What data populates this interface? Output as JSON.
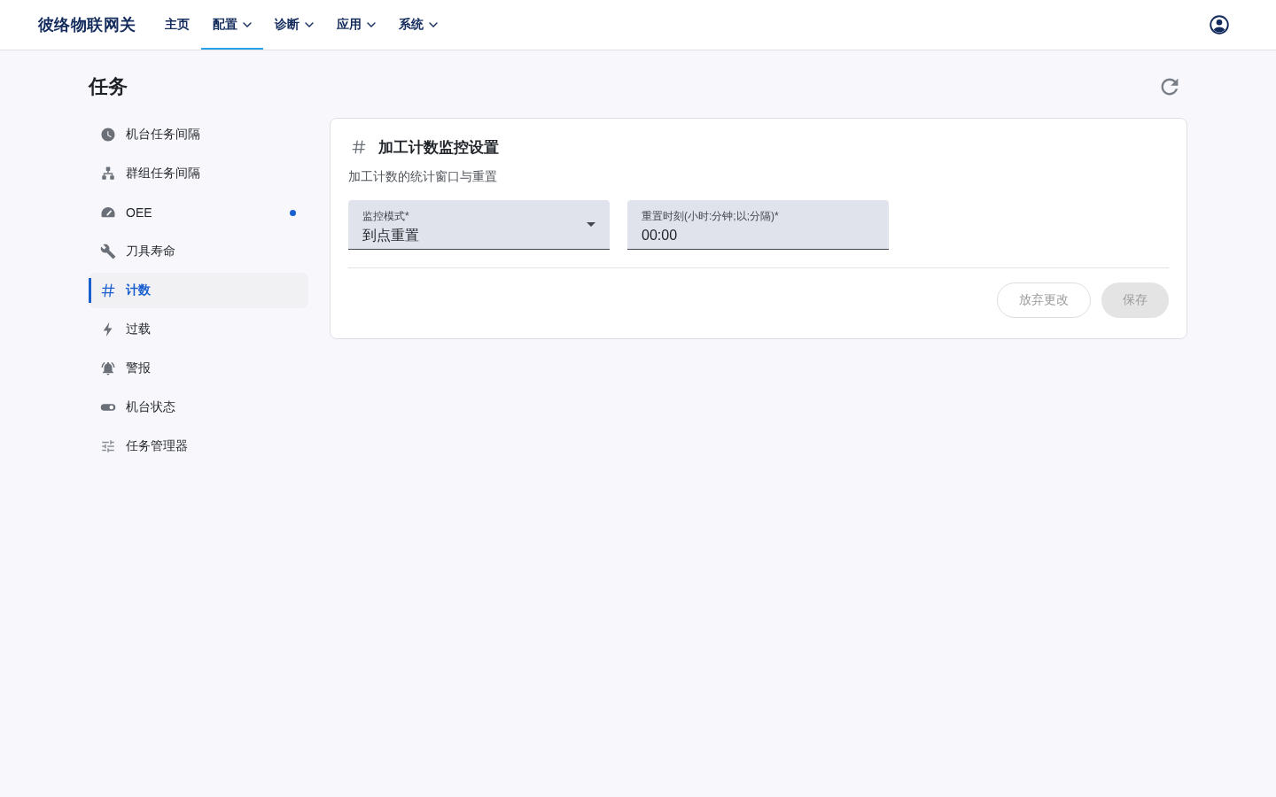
{
  "header": {
    "brand": "彼络物联网关",
    "nav": [
      {
        "label": "主页",
        "kind": "link",
        "selected": false
      },
      {
        "label": "配置",
        "kind": "menu",
        "selected": true
      },
      {
        "label": "诊断",
        "kind": "menu",
        "selected": false
      },
      {
        "label": "应用",
        "kind": "menu",
        "selected": false
      },
      {
        "label": "系统",
        "kind": "menu",
        "selected": false
      }
    ]
  },
  "page": {
    "title": "任务"
  },
  "sidebar": {
    "items": [
      {
        "label": "机台任务间隔",
        "selected": false,
        "dot": false
      },
      {
        "label": "群组任务间隔",
        "selected": false,
        "dot": false
      },
      {
        "label": "OEE",
        "selected": false,
        "dot": true
      },
      {
        "label": "刀具寿命",
        "selected": false,
        "dot": false
      },
      {
        "label": "计数",
        "selected": true,
        "dot": false
      },
      {
        "label": "过载",
        "selected": false,
        "dot": false
      },
      {
        "label": "警报",
        "selected": false,
        "dot": false
      },
      {
        "label": "机台状态",
        "selected": false,
        "dot": false
      },
      {
        "label": "任务管理器",
        "selected": false,
        "dot": false
      }
    ]
  },
  "card": {
    "title": "加工计数监控设置",
    "subtitle": "加工计数的统计窗口与重置",
    "fields": [
      {
        "kind": "select",
        "label": "监控模式*",
        "value": "到点重置"
      },
      {
        "kind": "text",
        "label": "重置时刻(小时:分钟;以;分隔)*",
        "value": "00:00"
      }
    ],
    "buttons": [
      {
        "kind": "outlined",
        "label": "放弃更改",
        "disabled": true
      },
      {
        "kind": "filled",
        "label": "保存",
        "disabled": true
      }
    ]
  }
}
